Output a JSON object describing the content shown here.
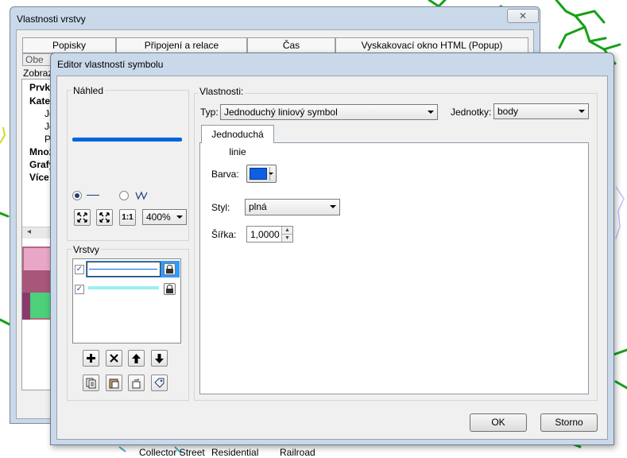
{
  "back_window": {
    "title": "Vlastnosti vrstvy",
    "close_label": "✕",
    "tabs_row1": [
      "Popisky",
      "Připojení a relace",
      "Čas",
      "Vyskakovací okno HTML (Popup)"
    ],
    "tabs_row2_first": "Obe",
    "left_panel_header": "Zobraz",
    "tree": [
      "Prvky",
      "Kateg",
      "Je",
      "Je",
      "Pl",
      "Množ",
      "Grafy",
      "Více"
    ],
    "bottom_row": [
      "Collector Street",
      "Residential",
      "Railroad"
    ]
  },
  "dialog": {
    "title": "Editor vlastností symbolu",
    "preview_label": "Náhled",
    "zoom_value": "400%",
    "layers_label": "Vrstvy",
    "properties_label": "Vlastnosti:",
    "type_label": "Typ:",
    "type_value": "Jednoduchý liniový symbol",
    "units_label": "Jednotky:",
    "units_value": "body",
    "tab_label": "Jednoduchá linie",
    "color_label": "Barva:",
    "style_label": "Styl:",
    "style_value": "plná",
    "width_label": "Šířka:",
    "width_value": "1,0000",
    "ok_label": "OK",
    "cancel_label": "Storno"
  },
  "colors": {
    "line_symbol": "#0066e0",
    "swatch": "#0f5fe6",
    "layer_selection": "#3399ff",
    "layer2_line": "#99f0f0"
  },
  "icons": {
    "layer_buttons": [
      "plus-icon",
      "delete-icon",
      "move-up-icon",
      "move-down-icon"
    ],
    "layer_tools": [
      "copy-icon",
      "paste-icon",
      "reset-icon",
      "tag-icon"
    ],
    "zoom_tools": [
      "fit-icon",
      "full-extent-icon",
      "actual-size-icon"
    ]
  }
}
